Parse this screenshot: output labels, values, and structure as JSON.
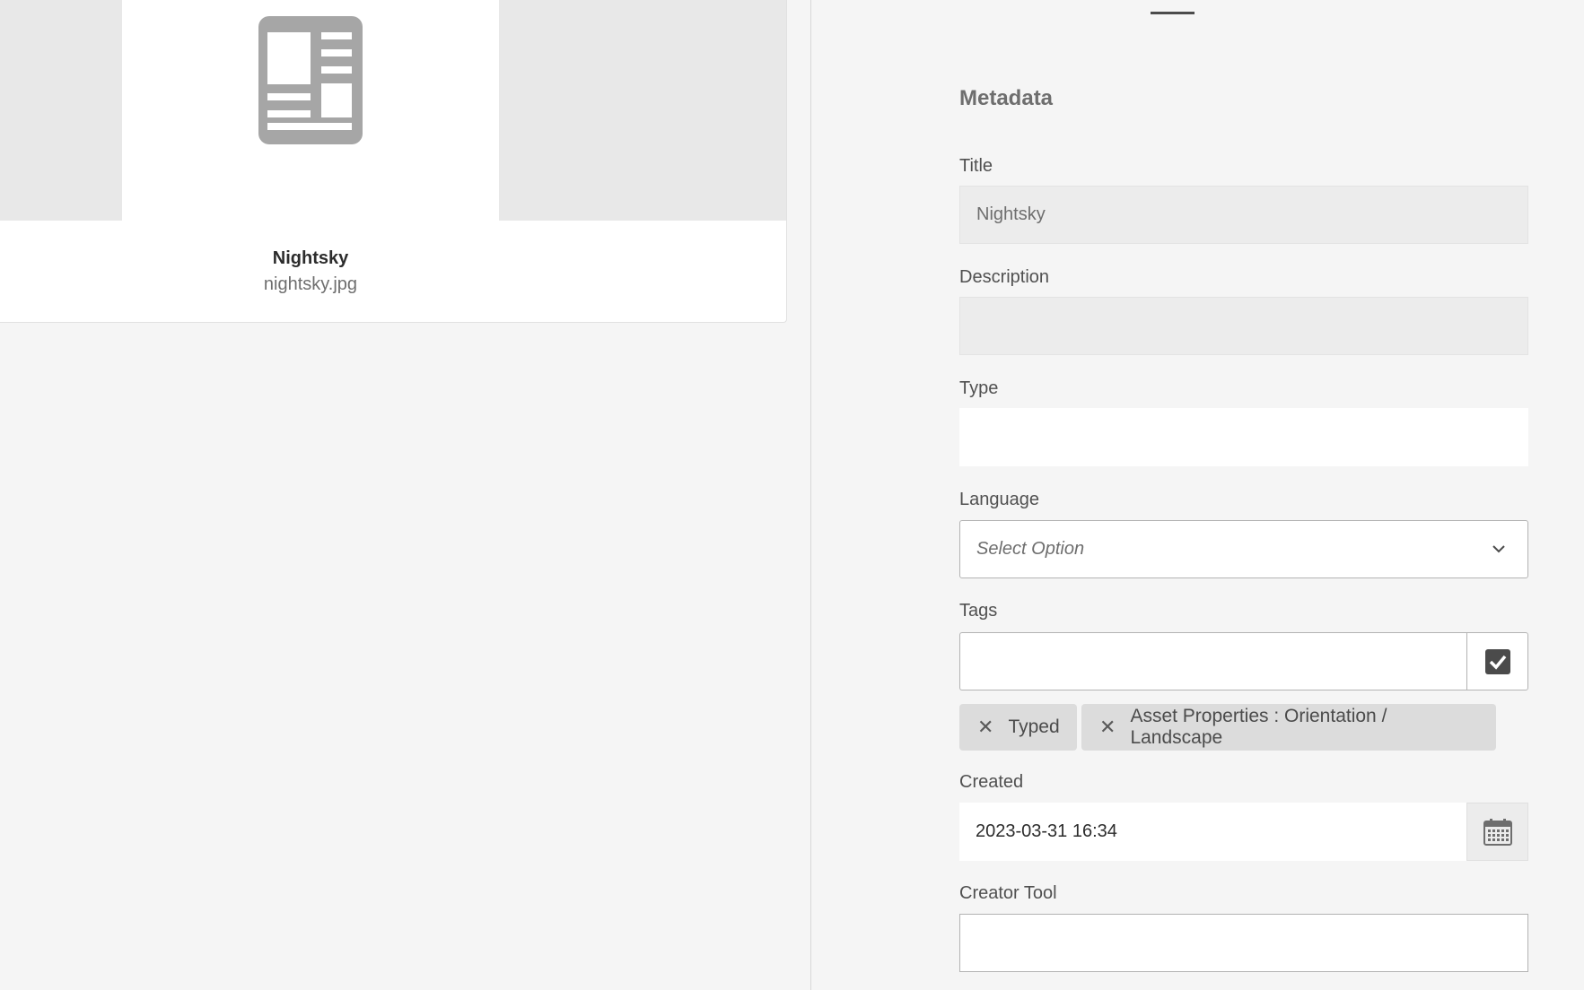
{
  "asset": {
    "title": "Nightsky",
    "filename": "nightsky.jpg"
  },
  "metadata": {
    "section_title": "Metadata",
    "fields": {
      "title": {
        "label": "Title",
        "value": "Nightsky"
      },
      "description": {
        "label": "Description",
        "value": ""
      },
      "type": {
        "label": "Type",
        "value": ""
      },
      "language": {
        "label": "Language",
        "placeholder": "Select Option"
      },
      "tags": {
        "label": "Tags",
        "chips": [
          "Typed",
          "Asset Properties : Orientation / Landscape"
        ]
      },
      "created": {
        "label": "Created",
        "value": "2023-03-31 16:34"
      },
      "creator_tool": {
        "label": "Creator Tool",
        "value": ""
      }
    }
  },
  "icons": {
    "thumbnail": "document-icon",
    "language_dropdown": "chevron-down-icon",
    "tags_picker": "checkbox-icon",
    "created_picker": "calendar-icon",
    "chip_remove": "close-icon"
  }
}
